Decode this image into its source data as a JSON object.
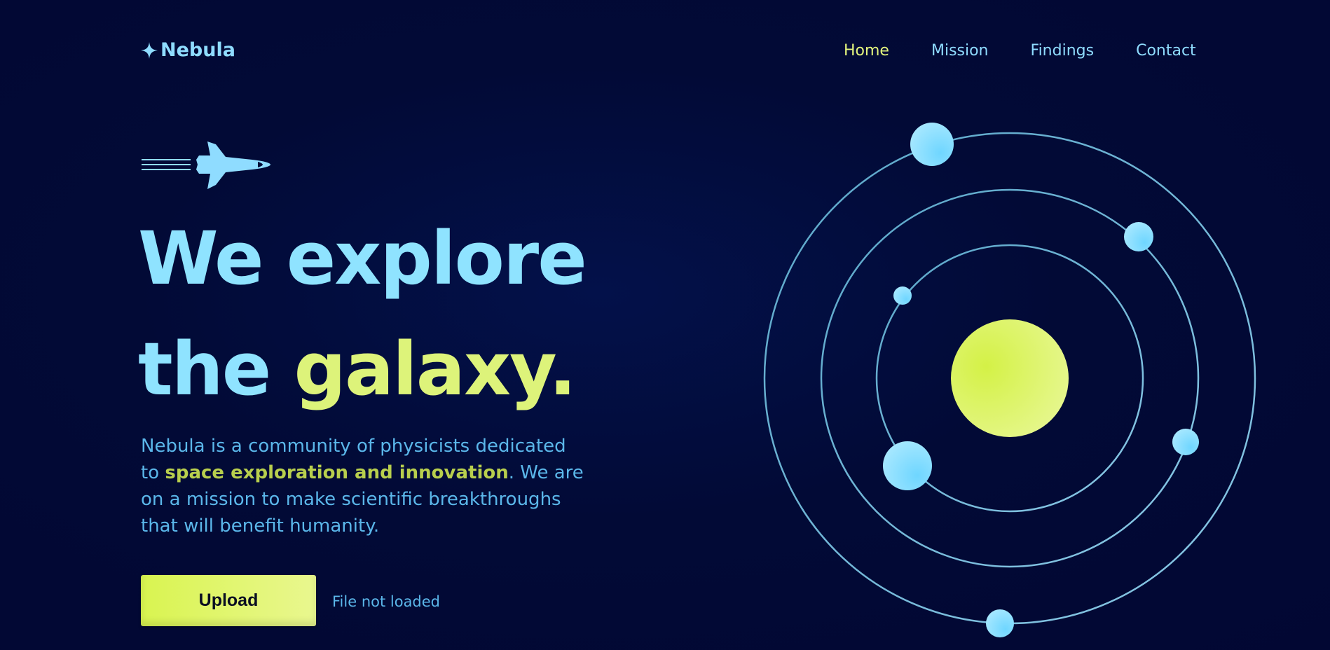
{
  "brand": {
    "name": "Nebula",
    "icon": "sparkle-star-icon"
  },
  "nav": {
    "items": [
      {
        "label": "Home",
        "active": true
      },
      {
        "label": "Mission",
        "active": false
      },
      {
        "label": "Findings",
        "active": false
      },
      {
        "label": "Contact",
        "active": false
      }
    ]
  },
  "hero": {
    "icon": "space-shuttle-icon",
    "headline_line1": "We explore",
    "headline_line2_plain": "the ",
    "headline_line2_accent": "galaxy.",
    "description_before": "Nebula is a community of physicists dedicated to ",
    "description_highlight": "space exploration and innovation",
    "description_after": ". We are on a mission to make scientific breakthroughs that will benefit humanity."
  },
  "upload": {
    "button_label": "Upload",
    "status": "File not loaded"
  },
  "colors": {
    "background": "#020a36",
    "primary_text": "#8fe3ff",
    "accent": "#ddf37a",
    "body_text": "#5bb7ea",
    "orbit_line": "#5fa8c9",
    "sun": "#d9f450",
    "planet": "#8fdcff"
  }
}
